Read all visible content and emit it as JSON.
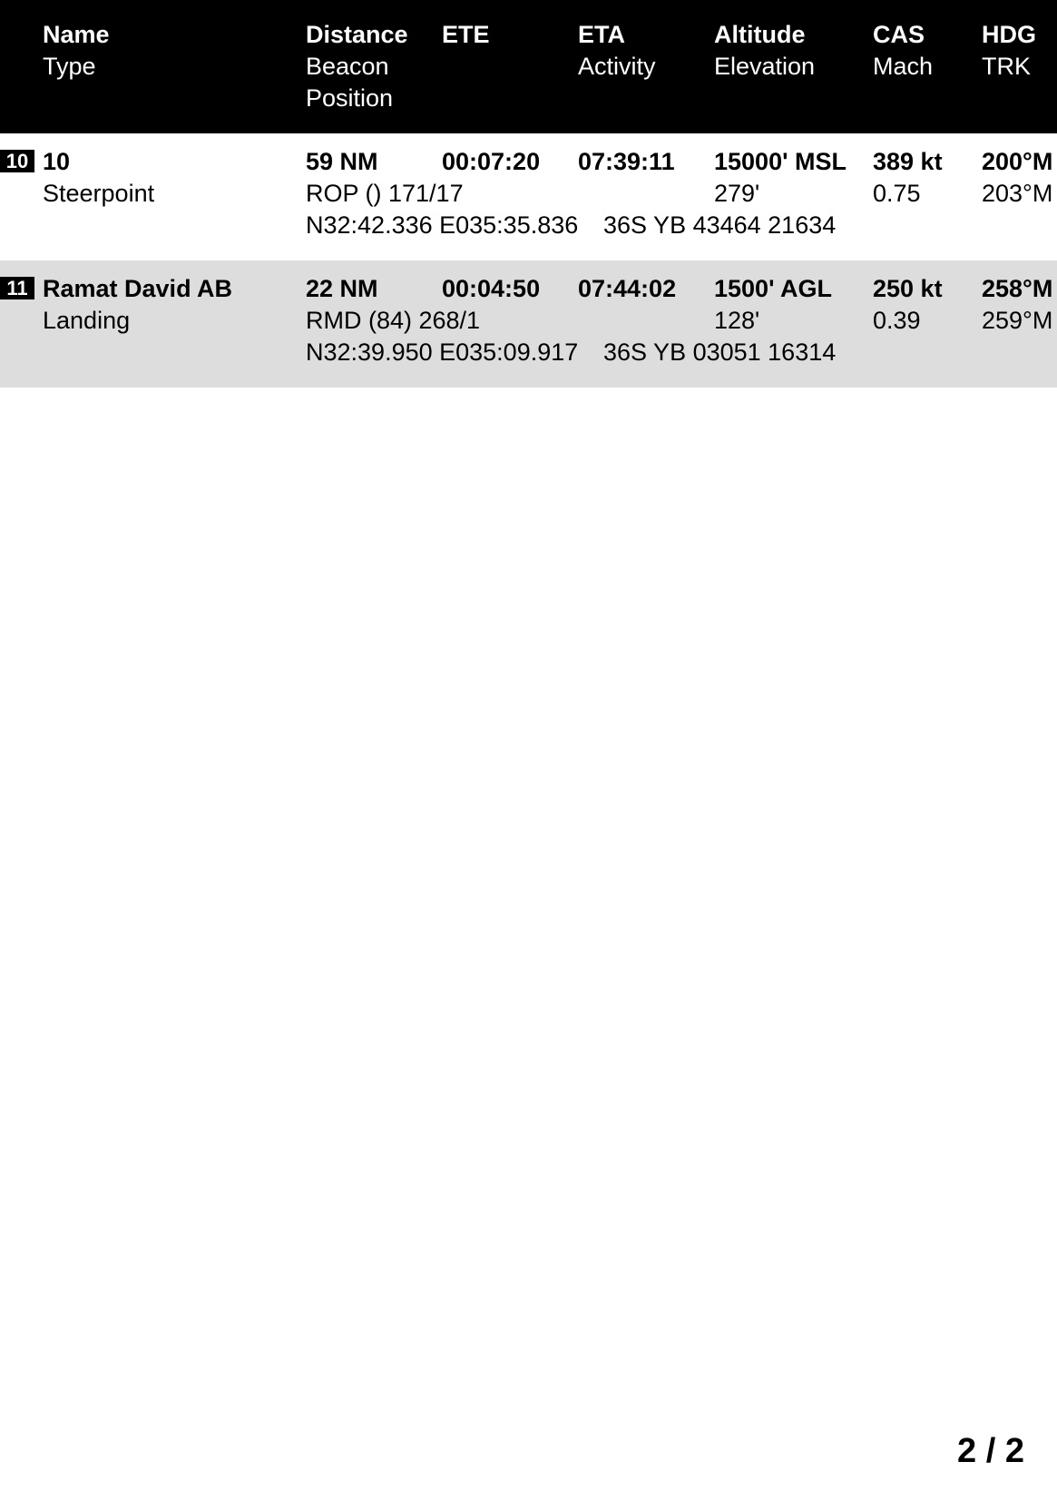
{
  "header": {
    "name": "Name",
    "type": "Type",
    "distance": "Distance",
    "beacon": "Beacon",
    "position": "Position",
    "ete": "ETE",
    "eta": "ETA",
    "activity": "Activity",
    "altitude": "Altitude",
    "elevation": "Elevation",
    "cas": "CAS",
    "mach": "Mach",
    "hdg": "HDG",
    "trk": "TRK"
  },
  "rows": [
    {
      "index": "10",
      "name": "10",
      "type": "Steerpoint",
      "distance": "59 NM",
      "ete": "00:07:20",
      "eta": "07:39:11",
      "altitude": "15000' MSL",
      "cas": "389 kt",
      "hdg": "200°M",
      "beacon": "ROP () 171/17",
      "elevation": "279'",
      "mach": "0.75",
      "trk": "203°M",
      "position": "N32:42.336 E035:35.836",
      "mgrs": "36S YB 43464 21634"
    },
    {
      "index": "11",
      "name": "Ramat David AB",
      "type": "Landing",
      "distance": "22 NM",
      "ete": "00:04:50",
      "eta": "07:44:02",
      "altitude": "1500' AGL",
      "cas": "250 kt",
      "hdg": "258°M",
      "beacon": "RMD (84) 268/1",
      "elevation": "128'",
      "mach": "0.39",
      "trk": "259°M",
      "position": "N32:39.950 E035:09.917",
      "mgrs": "36S YB 03051 16314"
    }
  ],
  "page": "2 / 2"
}
